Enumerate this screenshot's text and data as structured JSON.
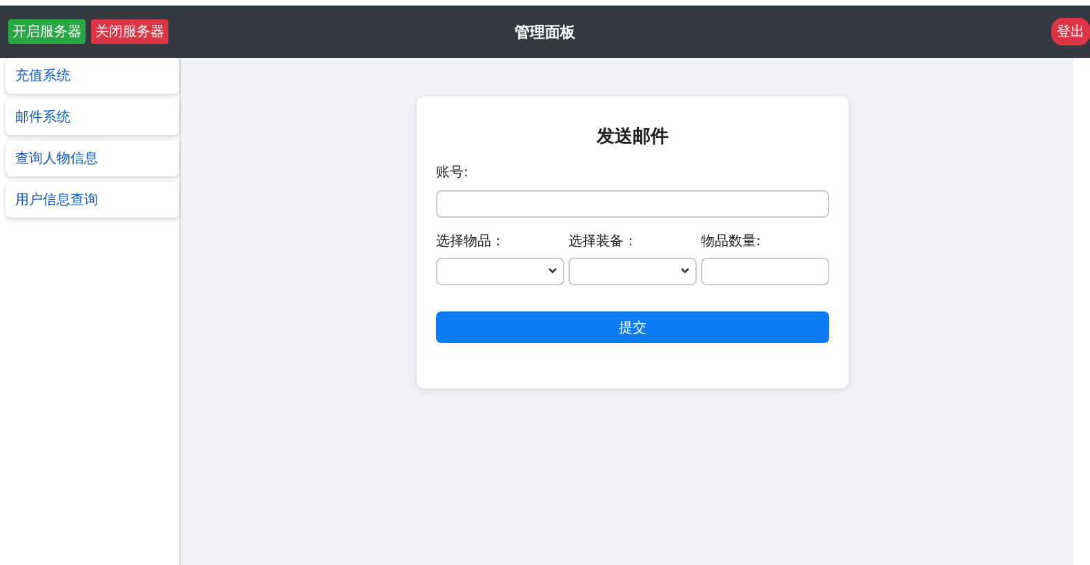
{
  "header": {
    "buttons": [
      {
        "label": "开启服务器",
        "kind": "success"
      },
      {
        "label": "关闭服务器",
        "kind": "danger"
      }
    ],
    "title": "管理面板",
    "logout": "登出"
  },
  "sidebar": {
    "items": [
      {
        "label": "充值系统"
      },
      {
        "label": "邮件系统"
      },
      {
        "label": "查询人物信息"
      },
      {
        "label": "用户信息查询"
      }
    ]
  },
  "form": {
    "title": "发送邮件",
    "account_label": "账号:",
    "item_label": "选择物品：",
    "equipment_label": "选择装备：",
    "quantity_label": "物品数量:",
    "submit": "提交"
  }
}
